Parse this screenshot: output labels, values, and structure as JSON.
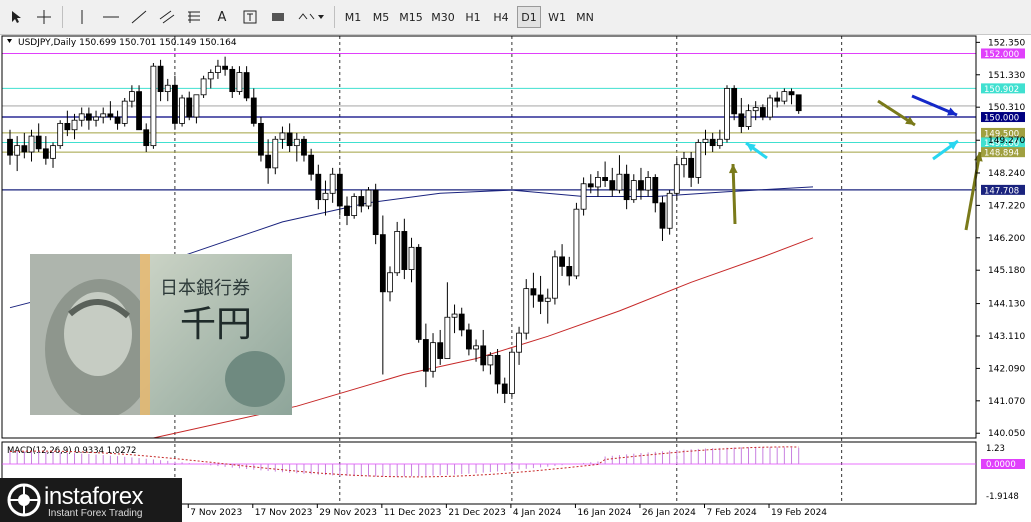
{
  "toolbar": {
    "timeframes": [
      "M1",
      "M5",
      "M15",
      "M30",
      "H1",
      "H4",
      "D1",
      "W1",
      "MN"
    ],
    "active_timeframe": "D1"
  },
  "chart_header": {
    "symbol_line": "USDJPY,Daily  150.699 150.701 150.149 150.164"
  },
  "colors": {
    "bull": "#ffffff",
    "bear": "#000000",
    "ma_blue": "#1a237e",
    "ma_red": "#c62828",
    "resistance": "#e040fb",
    "cyan": "#40e0d0",
    "olive": "#7a7a1a",
    "navy": "#00008b",
    "arrow_blue": "#1428c8",
    "arrow_cyan": "#29d6f0"
  },
  "chart_data": {
    "type": "candlestick",
    "y_ticks": [
      "152.350",
      "151.330",
      "150.310",
      "149.270",
      "148.240",
      "147.220",
      "146.200",
      "145.180",
      "144.130",
      "143.110",
      "142.090",
      "141.070",
      "140.050"
    ],
    "x_labels": [
      "7 Nov 2023",
      "17 Nov 2023",
      "29 Nov 2023",
      "11 Dec 2023",
      "21 Dec 2023",
      "4 Jan 2024",
      "16 Jan 2024",
      "26 Jan 2024",
      "7 Feb 2024",
      "19 Feb 2024"
    ],
    "levels": [
      {
        "label": "152.000",
        "value": 152.0,
        "color": "#e040fb"
      },
      {
        "label": "150.902",
        "value": 150.902,
        "color": "#40e0d0"
      },
      {
        "label": "150.000",
        "value": 150.0,
        "color": "#000080"
      },
      {
        "label": "149.500",
        "value": 149.5,
        "color": "#a0a040"
      },
      {
        "label": "149.200",
        "value": 149.2,
        "color": "#40e0d0"
      },
      {
        "label": "148.894",
        "value": 148.894,
        "color": "#a0a040"
      },
      {
        "label": "147.708",
        "value": 147.708,
        "color": "#1a237e"
      }
    ],
    "candles": [
      [
        149.3,
        149.6,
        148.5,
        148.8
      ],
      [
        148.8,
        149.4,
        148.3,
        149.1
      ],
      [
        149.1,
        149.5,
        148.7,
        148.9
      ],
      [
        148.9,
        149.6,
        148.6,
        149.4
      ],
      [
        149.4,
        149.8,
        148.9,
        149.0
      ],
      [
        149.0,
        149.4,
        148.5,
        148.7
      ],
      [
        148.7,
        149.2,
        148.4,
        149.1
      ],
      [
        149.1,
        149.9,
        149.0,
        149.8
      ],
      [
        149.8,
        150.2,
        149.4,
        149.6
      ],
      [
        149.6,
        150.1,
        149.3,
        149.9
      ],
      [
        149.9,
        150.3,
        149.7,
        150.1
      ],
      [
        150.1,
        150.3,
        149.6,
        149.9
      ],
      [
        149.9,
        150.2,
        149.7,
        150.0
      ],
      [
        150.0,
        150.3,
        149.8,
        150.1
      ],
      [
        150.1,
        150.5,
        149.9,
        150.0
      ],
      [
        150.0,
        150.2,
        149.6,
        149.8
      ],
      [
        149.8,
        150.6,
        149.7,
        150.5
      ],
      [
        150.5,
        151.0,
        150.3,
        150.8
      ],
      [
        150.8,
        151.0,
        149.6,
        149.6
      ],
      [
        149.6,
        149.8,
        148.9,
        149.1
      ],
      [
        149.1,
        151.7,
        149.0,
        151.6
      ],
      [
        151.6,
        151.8,
        150.5,
        150.8
      ],
      [
        150.8,
        151.2,
        150.5,
        151.0
      ],
      [
        151.0,
        151.3,
        149.6,
        149.8
      ],
      [
        149.8,
        150.7,
        149.7,
        150.6
      ],
      [
        150.6,
        150.8,
        149.9,
        150.0
      ],
      [
        150.0,
        150.7,
        149.8,
        150.7
      ],
      [
        150.7,
        151.3,
        150.6,
        151.2
      ],
      [
        151.2,
        151.5,
        150.9,
        151.4
      ],
      [
        151.4,
        151.8,
        151.2,
        151.6
      ],
      [
        151.6,
        151.9,
        151.3,
        151.5
      ],
      [
        151.5,
        151.6,
        150.6,
        150.8
      ],
      [
        150.8,
        151.6,
        150.7,
        151.4
      ],
      [
        151.4,
        151.6,
        150.5,
        150.6
      ],
      [
        150.6,
        150.9,
        149.7,
        149.8
      ],
      [
        149.8,
        150.0,
        148.6,
        148.8
      ],
      [
        148.8,
        149.3,
        147.9,
        148.4
      ],
      [
        148.4,
        149.4,
        148.2,
        149.3
      ],
      [
        149.3,
        149.7,
        149.0,
        149.5
      ],
      [
        149.5,
        149.8,
        148.9,
        149.1
      ],
      [
        149.1,
        149.5,
        148.6,
        149.3
      ],
      [
        149.3,
        149.4,
        148.6,
        148.8
      ],
      [
        148.8,
        149.0,
        148.0,
        148.2
      ],
      [
        148.2,
        148.5,
        147.1,
        147.4
      ],
      [
        147.4,
        148.0,
        146.9,
        147.6
      ],
      [
        147.6,
        148.4,
        147.3,
        148.2
      ],
      [
        148.2,
        148.4,
        146.9,
        147.2
      ],
      [
        147.2,
        147.5,
        146.6,
        146.9
      ],
      [
        146.9,
        147.6,
        146.8,
        147.5
      ],
      [
        147.5,
        147.7,
        147.0,
        147.2
      ],
      [
        147.2,
        147.8,
        147.1,
        147.7
      ],
      [
        147.7,
        147.9,
        146.0,
        146.3
      ],
      [
        146.3,
        146.9,
        141.9,
        144.5
      ],
      [
        144.5,
        145.3,
        144.2,
        145.1
      ],
      [
        145.1,
        146.7,
        145.0,
        146.4
      ],
      [
        146.4,
        146.8,
        144.9,
        145.2
      ],
      [
        145.2,
        146.2,
        144.8,
        145.9
      ],
      [
        145.9,
        146.0,
        142.9,
        143.0
      ],
      [
        143.0,
        143.5,
        141.5,
        142.0
      ],
      [
        142.0,
        143.2,
        141.8,
        142.9
      ],
      [
        142.9,
        143.3,
        142.2,
        142.4
      ],
      [
        142.4,
        144.8,
        142.4,
        143.7
      ],
      [
        143.7,
        144.1,
        143.2,
        143.8
      ],
      [
        143.8,
        144.0,
        143.1,
        143.3
      ],
      [
        143.3,
        143.5,
        142.5,
        142.7
      ],
      [
        142.7,
        143.0,
        142.3,
        142.8
      ],
      [
        142.8,
        143.3,
        142.0,
        142.2
      ],
      [
        142.2,
        142.6,
        141.9,
        142.5
      ],
      [
        142.5,
        142.7,
        141.3,
        141.6
      ],
      [
        141.6,
        141.8,
        141.0,
        141.3
      ],
      [
        141.3,
        142.7,
        141.2,
        142.6
      ],
      [
        142.6,
        143.4,
        142.2,
        143.2
      ],
      [
        143.2,
        144.9,
        143.0,
        144.6
      ],
      [
        144.6,
        145.1,
        144.0,
        144.4
      ],
      [
        144.4,
        145.0,
        143.8,
        144.2
      ],
      [
        144.2,
        144.6,
        143.5,
        144.3
      ],
      [
        144.3,
        145.8,
        144.1,
        145.6
      ],
      [
        145.6,
        146.0,
        145.0,
        145.3
      ],
      [
        145.3,
        145.6,
        144.7,
        145.0
      ],
      [
        145.0,
        147.3,
        144.9,
        147.1
      ],
      [
        147.1,
        148.1,
        146.9,
        147.9
      ],
      [
        147.9,
        148.2,
        147.6,
        147.8
      ],
      [
        147.8,
        148.3,
        147.5,
        148.1
      ],
      [
        148.1,
        148.6,
        147.8,
        148.0
      ],
      [
        148.0,
        148.4,
        147.5,
        147.7
      ],
      [
        147.7,
        148.8,
        147.6,
        148.2
      ],
      [
        148.2,
        148.5,
        147.1,
        147.4
      ],
      [
        147.4,
        148.2,
        147.3,
        148.0
      ],
      [
        148.0,
        148.4,
        147.4,
        147.7
      ],
      [
        147.7,
        148.3,
        147.5,
        148.1
      ],
      [
        148.1,
        148.2,
        147.0,
        147.3
      ],
      [
        147.3,
        147.5,
        146.1,
        146.5
      ],
      [
        146.5,
        147.7,
        146.3,
        147.6
      ],
      [
        147.6,
        148.7,
        147.4,
        148.5
      ],
      [
        148.5,
        148.9,
        148.1,
        148.7
      ],
      [
        148.7,
        148.9,
        147.8,
        148.1
      ],
      [
        148.1,
        149.3,
        147.9,
        149.2
      ],
      [
        149.2,
        149.6,
        148.8,
        149.3
      ],
      [
        149.3,
        149.5,
        148.9,
        149.1
      ],
      [
        149.1,
        149.6,
        149.0,
        149.3
      ],
      [
        149.3,
        151.0,
        149.2,
        150.9
      ],
      [
        150.9,
        151.0,
        149.9,
        150.1
      ],
      [
        150.1,
        150.6,
        149.5,
        149.7
      ],
      [
        149.7,
        150.4,
        149.6,
        150.2
      ],
      [
        150.2,
        150.5,
        149.9,
        150.3
      ],
      [
        150.3,
        150.4,
        149.9,
        150.0
      ],
      [
        150.0,
        150.7,
        149.9,
        150.6
      ],
      [
        150.6,
        150.8,
        150.3,
        150.5
      ],
      [
        150.5,
        150.9,
        150.4,
        150.8
      ],
      [
        150.8,
        150.9,
        150.4,
        150.7
      ],
      [
        150.7,
        150.7,
        150.1,
        150.2
      ]
    ],
    "ma_blue": [
      [
        0,
        144.0
      ],
      [
        12,
        144.7
      ],
      [
        25,
        145.7
      ],
      [
        38,
        146.7
      ],
      [
        50,
        147.3
      ],
      [
        60,
        147.6
      ],
      [
        70,
        147.7
      ],
      [
        80,
        147.5
      ],
      [
        90,
        147.5
      ],
      [
        100,
        147.65
      ],
      [
        112,
        147.8
      ]
    ],
    "ma_red": [
      [
        20,
        139.9
      ],
      [
        40,
        140.9
      ],
      [
        55,
        141.9
      ],
      [
        65,
        142.4
      ],
      [
        75,
        143.1
      ],
      [
        85,
        143.9
      ],
      [
        95,
        144.8
      ],
      [
        105,
        145.6
      ],
      [
        112,
        146.2
      ]
    ],
    "macd": {
      "label": "MACD(12,26,9) 0.9334 1.0272",
      "ticks": [
        "1.23",
        "0.0000",
        "-1.9148"
      ]
    }
  },
  "logo": {
    "brand": "instaforex",
    "tagline": "Instant Forex Trading"
  }
}
